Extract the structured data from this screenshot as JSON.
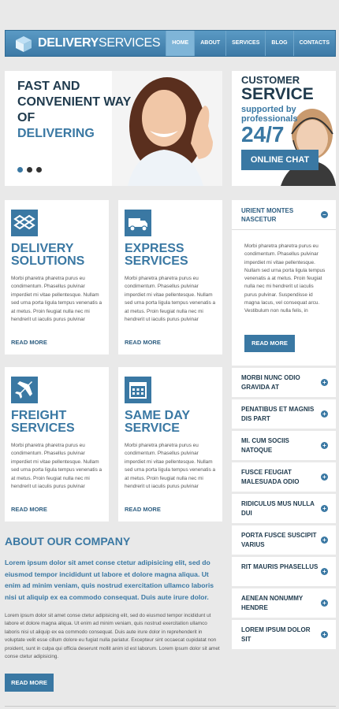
{
  "header": {
    "logo_bold": "DELIVERY",
    "logo_thin": "SERVICES",
    "nav": [
      {
        "label": "HOME"
      },
      {
        "label": "ABOUT"
      },
      {
        "label": "SERVICES"
      },
      {
        "label": "BLOG"
      },
      {
        "label": "CONTACTS"
      }
    ]
  },
  "hero": {
    "line1": "FAST AND",
    "line2": "CONVENIENT WAY",
    "line3": "OF",
    "line4": "DELIVERING"
  },
  "chat": {
    "title1": "CUSTOMER",
    "title2": "SERVICE",
    "sub": "supported by professionals",
    "hours": "24/7",
    "button": "ONLINE CHAT"
  },
  "cards": [
    {
      "title": "DELIVERY SOLUTIONS",
      "icon": "dropbox-icon",
      "body": "Morbi pharetra pharetra purus eu condimentum. Phasellus pulvinar imperdiet mi vitae pellentesque. Nullam sed urna porta ligula tempus venenatis a at metus. Proin feugiat nulla nec mi hendrerit ut iaculis purus pulvinar",
      "link": "READ MORE"
    },
    {
      "title": "EXPRESS SERVICES",
      "icon": "truck-icon",
      "body": "Morbi pharetra pharetra purus eu condimentum. Phasellus pulvinar imperdiet mi vitae pellentesque. Nullam sed urna porta ligula tempus venenatis a at metus. Proin feugiat nulla nec mi hendrerit ut iaculis purus pulvinar",
      "link": "READ MORE"
    },
    {
      "title": "FREIGHT SERVICES",
      "icon": "airplane-icon",
      "body": "Morbi pharetra pharetra purus eu condimentum. Phasellus pulvinar imperdiet mi vitae pellentesque. Nullam sed urna porta ligula tempus venenatis a at metus. Proin feugiat nulla nec mi hendrerit ut iaculis purus pulvinar",
      "link": "READ MORE"
    },
    {
      "title": "SAME DAY SERVICE",
      "icon": "calendar-icon",
      "body": "Morbi pharetra pharetra purus eu condimentum. Phasellus pulvinar imperdiet mi vitae pellentesque. Nullam sed urna porta ligula tempus venenatis a at metus. Proin feugiat nulla nec mi hendrerit ut iaculis purus pulvinar",
      "link": "READ MORE"
    }
  ],
  "accordion": {
    "open_title": "URIENT MONTES NASCETUR",
    "open_body": "Morbi pharetra pharetra purus eu condimentum. Phasellus pulvinar imperdiet mi vitae pellentesque. Nullam sed urna porta ligula tempus venenatis a at metus. Proin feugiat nulla nec mi hendrerit ut iaculis purus pulvinar. Suspendisse id magna lacus, vel consequat arcu. Vestibulum non nulla felis, in",
    "open_button": "READ MORE",
    "items": [
      {
        "label": "MORBI NUNC ODIO GRAVIDA AT"
      },
      {
        "label": "PENATIBUS ET MAGNIS DIS PART"
      },
      {
        "label": "MI. CUM SOCIIS NATOQUE"
      },
      {
        "label": "FUSCE FEUGIAT MALESUADA ODIO"
      },
      {
        "label": "RIDICULUS MUS NULLA DUI"
      },
      {
        "label": "PORTA FUSCE SUSCIPIT VARIUS"
      },
      {
        "label": "RIT MAURIS PHASELLUS"
      },
      {
        "label": "AENEAN NONUMMY HENDRE"
      },
      {
        "label": "LOREM IPSUM DOLOR SIT"
      }
    ]
  },
  "about": {
    "title": "ABOUT OUR COMPANY",
    "lead": "Lorem ipsum dolor sit amet conse ctetur adipisicing elit, sed do eiusmod tempor incididunt ut labore et dolore magna aliqua. Ut enim ad minim veniam, quis nostrud exercitation ullamco laboris nisi ut aliquip ex ea commodo consequat. Duis aute irure dolor.",
    "body": "Lorem ipsum dolor sit amet conse ctetur adipisicing elit, sed do eiusmod tempor incididunt ut labore et dolore magna aliqua. Ut enim ad minim veniam, quis nostrud exercitation ullamco laboris nisi ut aliquip ex ea commodo consequat. Duis aute irure dolor in reprehenderit in voluptate velit esse cillum dolore eu fugiat nulla pariatur. Excepteur sint occaecat cupidatat non proident, sunt in culpa qui officia deserunt mollit anim id est laborum. Lorem ipsum dolor sit amet conse ctetur adipisicing.",
    "button": "READ MORE"
  },
  "colors": {
    "accent": "#3a78a3",
    "dark": "#1f3a4d"
  }
}
